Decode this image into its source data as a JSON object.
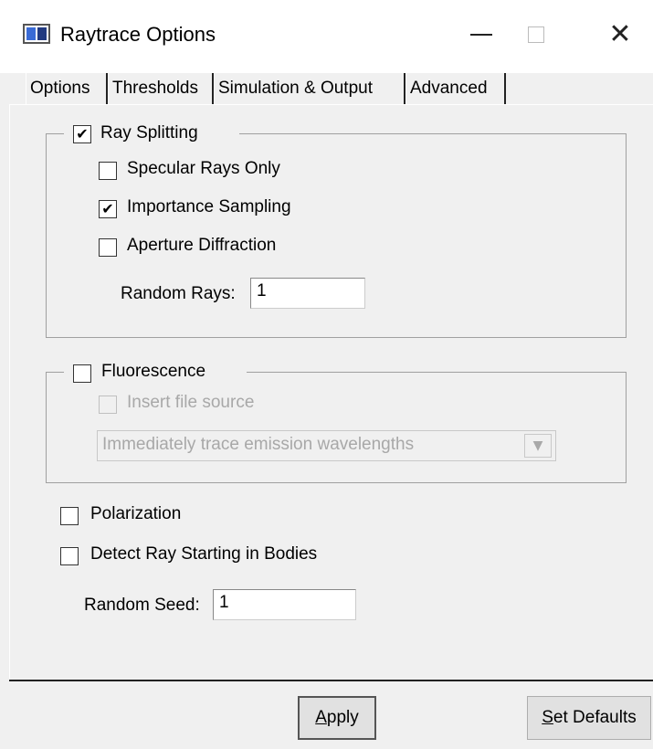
{
  "window": {
    "title": "Raytrace Options",
    "controls": {
      "minimize_icon": "minimize-icon",
      "maximize_icon": "maximize-icon",
      "close_glyph": "✕"
    }
  },
  "tabs": [
    {
      "label": "Options",
      "active": true
    },
    {
      "label": "Thresholds",
      "active": false
    },
    {
      "label": "Simulation & Output",
      "active": false
    },
    {
      "label": "Advanced",
      "active": false
    }
  ],
  "ray_splitting": {
    "label": "Ray Splitting",
    "checked": true,
    "specular_only": {
      "label": "Specular Rays Only",
      "checked": false
    },
    "importance_sampling": {
      "label": "Importance Sampling",
      "checked": true
    },
    "aperture_diffraction": {
      "label": "Aperture Diffraction",
      "checked": false
    },
    "random_rays": {
      "label": "Random Rays:",
      "value": "1"
    }
  },
  "fluorescence": {
    "label": "Fluorescence",
    "checked": false,
    "insert_file_source": {
      "label": "Insert file source",
      "checked": false,
      "enabled": false
    },
    "emission_mode": {
      "selected": "Immediately trace emission wavelengths",
      "enabled": false
    }
  },
  "polarization": {
    "label": "Polarization",
    "checked": false
  },
  "detect_ray_bodies": {
    "label": "Detect Ray Starting in Bodies",
    "checked": false
  },
  "random_seed": {
    "label": "Random Seed:",
    "value": "1"
  },
  "buttons": {
    "apply": {
      "prefix": "A",
      "rest": "pply"
    },
    "set_defaults": {
      "prefix": "S",
      "rest": "et Defaults"
    }
  },
  "colors": {
    "background": "#f0f0f0",
    "titlebar": "#ffffff",
    "disabled_text": "#a8a8a8"
  }
}
